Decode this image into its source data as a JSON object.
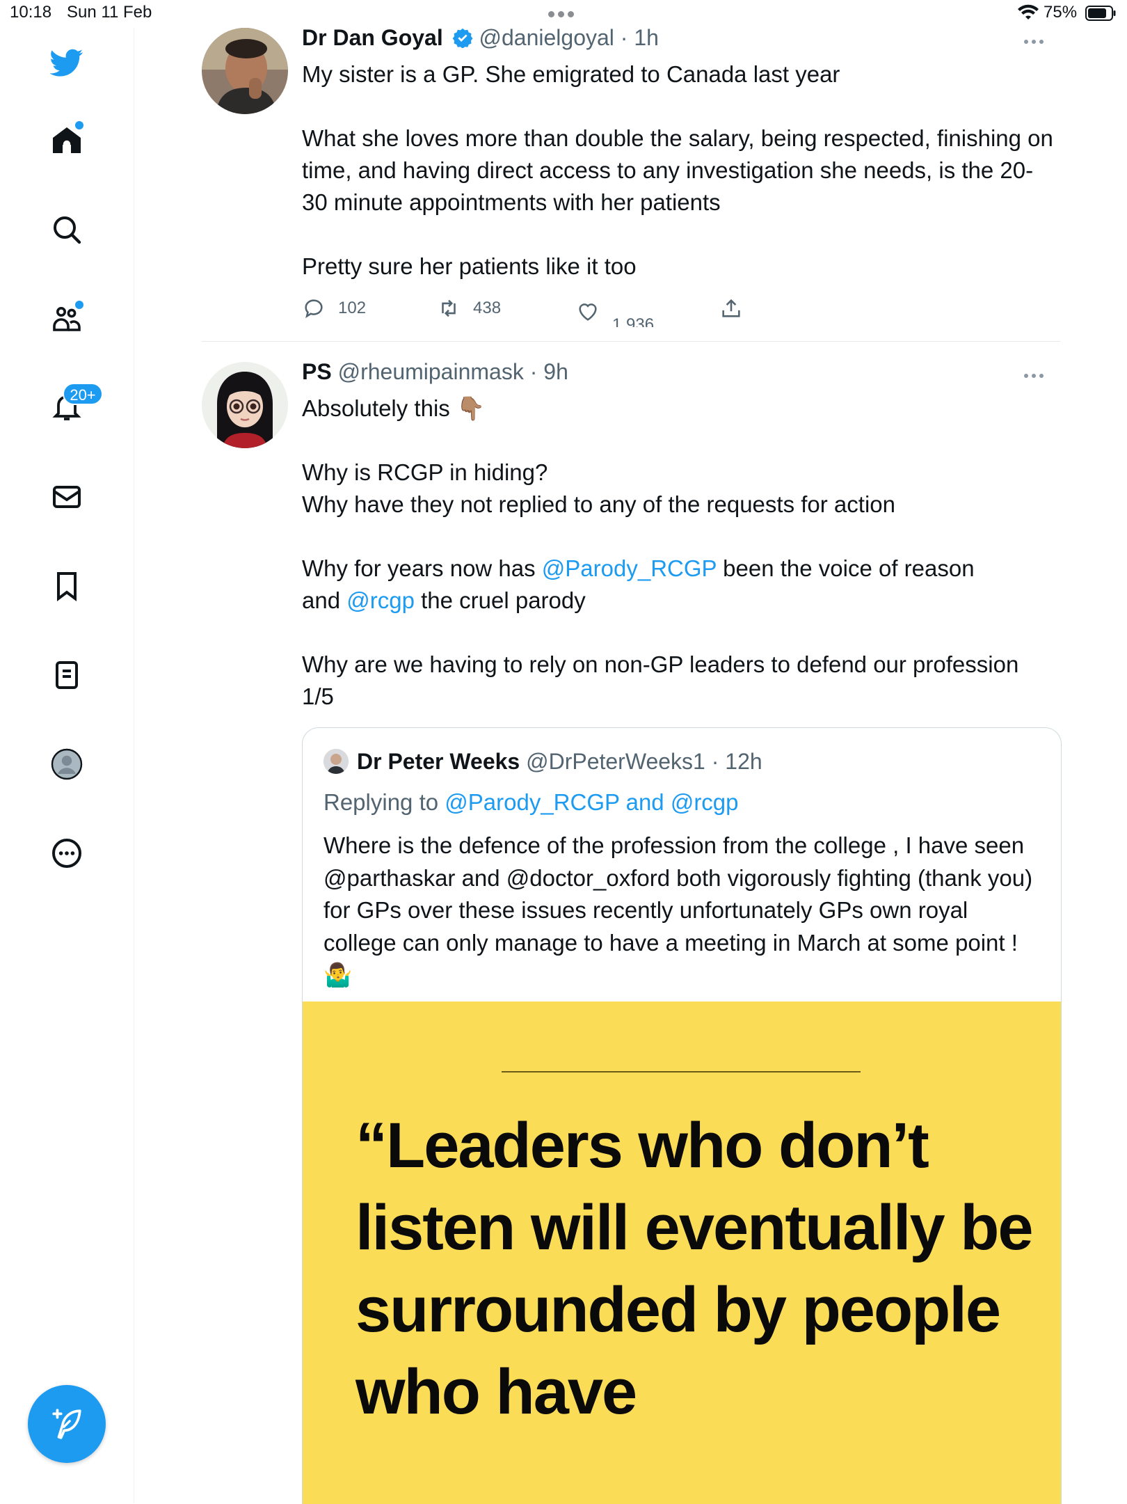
{
  "status_bar": {
    "time": "10:18",
    "date": "Sun 11 Feb",
    "battery": "75%"
  },
  "sidebar": {
    "notifications_badge": "20+"
  },
  "tweets": [
    {
      "name": "Dr Dan Goyal",
      "handle": "@danielgoyal",
      "time": "· 1h",
      "paragraphs": [
        "My sister is a GP. She emigrated to Canada last year",
        "What she loves more than double the salary, being respected, finishing on time, and having direct access to any investigation she needs, is the 20-30 minute appointments with her patients",
        "Pretty sure her patients like it too"
      ],
      "replies": "102",
      "retweets": "438",
      "likes": "1,936"
    },
    {
      "name": "PS",
      "handle": "@rheumipainmask",
      "time": "· 9h",
      "line1": "Absolutely this 👇🏽",
      "line2": "Why is RCGP in hiding?",
      "line3": "Why have they not replied to any of the requests for action",
      "line4_a": "Why for years now has ",
      "line4_m1": "@Parody_RCGP",
      "line4_b": " been the voice of reason",
      "line4_c": "and ",
      "line4_m2": "@rcgp",
      "line4_d": " the cruel parody",
      "line5": "Why are we having to rely on non-GP leaders to defend our profession",
      "line6": "1/5",
      "quoted": {
        "name": "Dr Peter Weeks",
        "handle": "@DrPeterWeeks1",
        "time": "· 12h",
        "replying_label": "Replying to ",
        "replying_mentions": "@Parody_RCGP and @rcgp",
        "body": "Where is the defence of the profession from the college , I have seen @parthaskar and @doctor_oxford  both vigorously fighting (thank you)  for GPs over these issues recently unfortunately GPs own royal college can only manage to have a meeting in March at some point  !  🤷‍♂️",
        "image_quote": "“Leaders who don’t listen will eventually be surrounded by people who have"
      }
    }
  ]
}
